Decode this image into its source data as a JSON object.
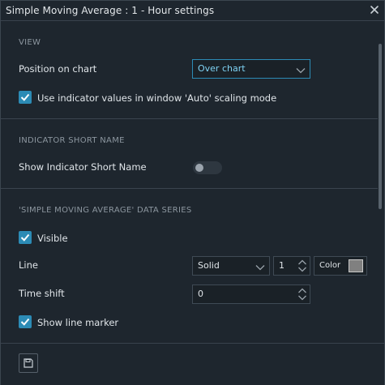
{
  "dialog": {
    "title": "Simple Moving Average : 1 - Hour settings"
  },
  "view": {
    "section_title": "VIEW",
    "position_label": "Position on chart",
    "position_value": "Over chart",
    "auto_scaling_label": "Use indicator values in window 'Auto' scaling mode",
    "auto_scaling_checked": true
  },
  "short_name": {
    "section_title": "INDICATOR SHORT NAME",
    "show_label": "Show Indicator Short Name",
    "show_enabled": false
  },
  "series": {
    "section_title": "'SIMPLE MOVING AVERAGE' DATA SERIES",
    "visible_label": "Visible",
    "visible_checked": true,
    "line_label": "Line",
    "line_style": "Solid",
    "line_width": "1",
    "color_label": "Color",
    "color_value": "#808080",
    "time_shift_label": "Time shift",
    "time_shift_value": "0",
    "marker_label": "Show line marker",
    "marker_checked": true
  },
  "icons": {
    "close": "close-icon",
    "check": "checkmark-icon",
    "chevron": "chevron-down-icon",
    "spin": "spin-arrows-icon",
    "save": "save-icon"
  },
  "colors": {
    "accent": "#2c8bb5",
    "background": "#1e262e"
  }
}
